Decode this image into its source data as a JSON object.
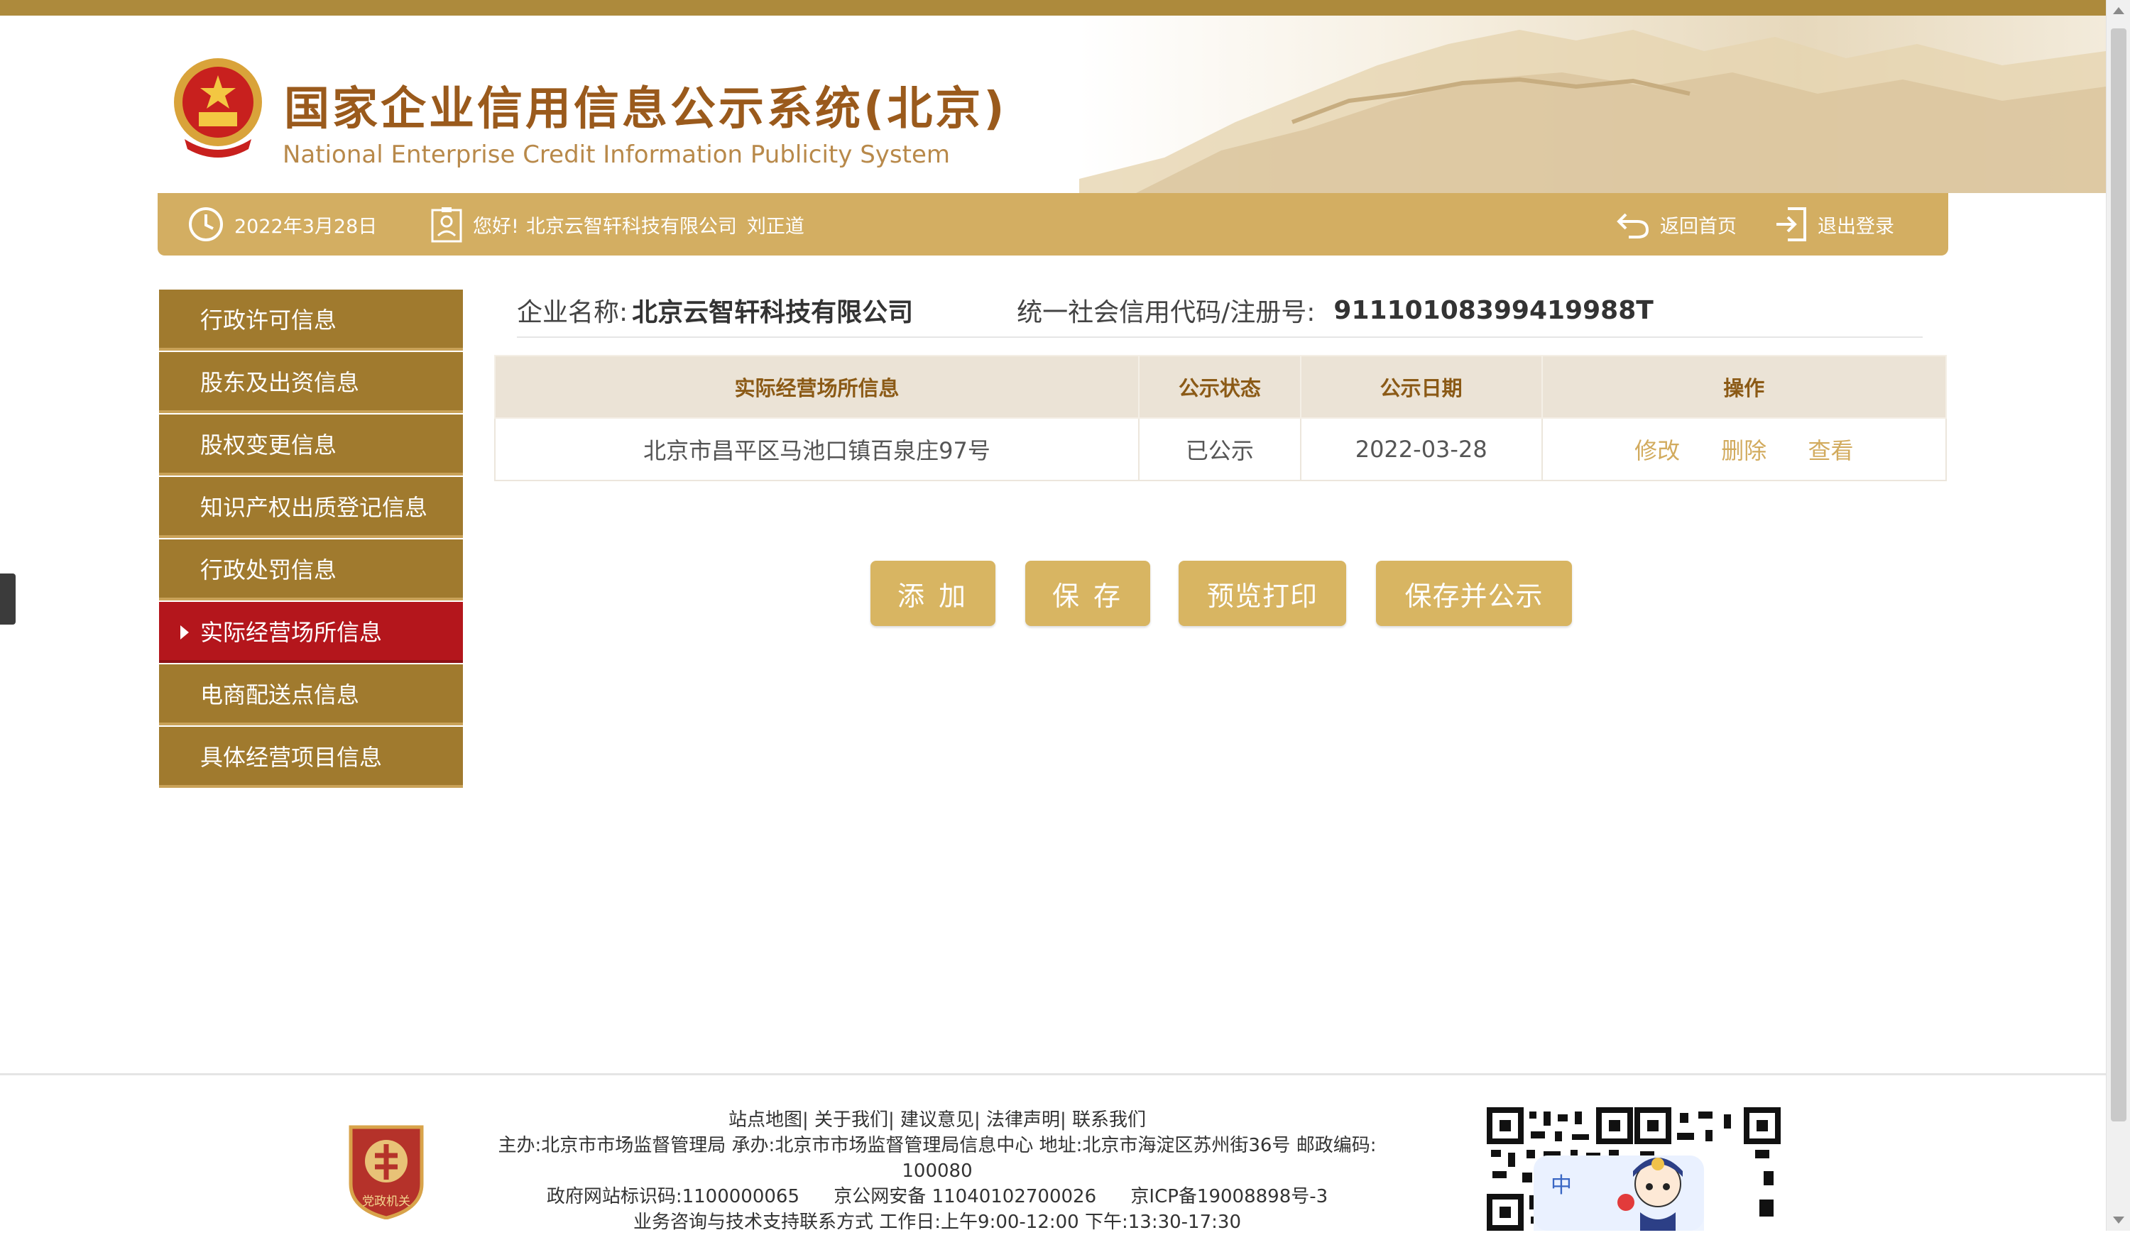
{
  "header": {
    "title": "国家企业信用信息公示系统(北京)",
    "subtitle": "National Enterprise Credit Information Publicity System"
  },
  "infobar": {
    "date": "2022年3月28日",
    "greeting": "您好!",
    "company": "北京云智轩科技有限公司",
    "user": "刘正道",
    "home_label": "返回首页",
    "logout_label": "退出登录"
  },
  "sidebar": {
    "items": [
      {
        "label": "行政许可信息"
      },
      {
        "label": "股东及出资信息"
      },
      {
        "label": "股权变更信息"
      },
      {
        "label": "知识产权出质登记信息"
      },
      {
        "label": "行政处罚信息"
      },
      {
        "label": "实际经营场所信息",
        "active": true
      },
      {
        "label": "电商配送点信息"
      },
      {
        "label": "具体经营项目信息"
      }
    ]
  },
  "company_info": {
    "name_label": "企业名称:",
    "name": "北京云智轩科技有限公司",
    "code_label": "统一社会信用代码/注册号:",
    "code": "91110108399419988T"
  },
  "table": {
    "headers": [
      "实际经营场所信息",
      "公示状态",
      "公示日期",
      "操作"
    ],
    "rows": [
      {
        "address": "北京市昌平区马池口镇百泉庄97号",
        "status": "已公示",
        "date": "2022-03-28",
        "ops": [
          "修改",
          "删除",
          "查看"
        ]
      }
    ]
  },
  "buttons": {
    "add": "添 加",
    "save": "保 存",
    "preview": "预览打印",
    "save_publish": "保存并公示"
  },
  "footer": {
    "links": "站点地图| 关于我们| 建议意见| 法律声明| 联系我们",
    "host_line": "主办:北京市市场监督管理局 承办:北京市市场监督管理局信息中心 地址:北京市海淀区苏州街36号 邮政编码:",
    "postcode": "100080",
    "site_id": "政府网站标识码:1100000065",
    "police": "京公网安备 11040102700026",
    "icp": "京ICP备19008898号-3",
    "service_line": "业务咨询与技术支持联系方式 工作日:上午9:00-12:00 下午:13:30-17:30",
    "badge_text": "党政机关",
    "mascot_text": "中"
  },
  "colors": {
    "gold": "#d3ae62",
    "sidebar_bg": "#a07a2e",
    "active": "#b4161c",
    "title": "#9a5a1c"
  }
}
